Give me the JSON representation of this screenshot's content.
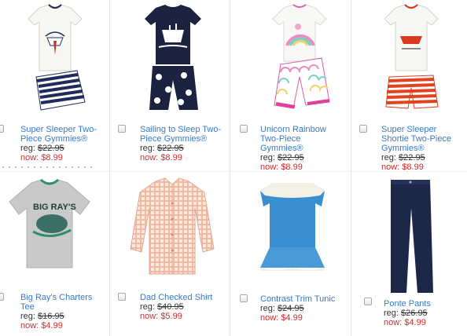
{
  "products": [
    {
      "name": "Super Sleeper Two-Piece Gymmies®",
      "reg_label": "reg:",
      "reg_price": "$22.95",
      "now_label": "now:",
      "now_price": "$8.99",
      "icon": "shark-pajama-icon"
    },
    {
      "name": "Sailing to Sleep Two-Piece Gymmies®",
      "reg_label": "reg:",
      "reg_price": "$22.95",
      "now_label": "now:",
      "now_price": "$8.99",
      "icon": "ship-pajama-icon"
    },
    {
      "name": "Unicorn Rainbow Two-Piece Gymmies®",
      "reg_label": "reg:",
      "reg_price": "$22.95",
      "now_label": "now:",
      "now_price": "$8.99",
      "icon": "unicorn-pajama-icon"
    },
    {
      "name": "Super Sleeper Shortie Two-Piece Gymmies®",
      "reg_label": "reg:",
      "reg_price": "$22.95",
      "now_label": "now:",
      "now_price": "$8.99",
      "icon": "shortie-pajama-icon"
    },
    {
      "name": "Big Ray's Charters Tee",
      "reg_label": "reg:",
      "reg_price": "$16.95",
      "now_label": "now:",
      "now_price": "$4.99",
      "icon": "tee-icon",
      "shirt_text": "BIG RAY'S"
    },
    {
      "name": "Dad Checked Shirt",
      "reg_label": "reg:",
      "reg_price": "$40.95",
      "now_label": "now:",
      "now_price": "$5.99",
      "icon": "checked-shirt-icon"
    },
    {
      "name": "Contrast Trim Tunic",
      "reg_label": "reg:",
      "reg_price": "$24.95",
      "now_label": "now:",
      "now_price": "$4.99",
      "icon": "tunic-icon"
    },
    {
      "name": "Ponte Pants",
      "reg_label": "reg:",
      "reg_price": "$26.95",
      "now_label": "now:",
      "now_price": "$4.99",
      "icon": "pants-icon"
    }
  ],
  "colors": {
    "link": "#3a78c2",
    "sale": "#d32b2b",
    "text": "#333333"
  }
}
